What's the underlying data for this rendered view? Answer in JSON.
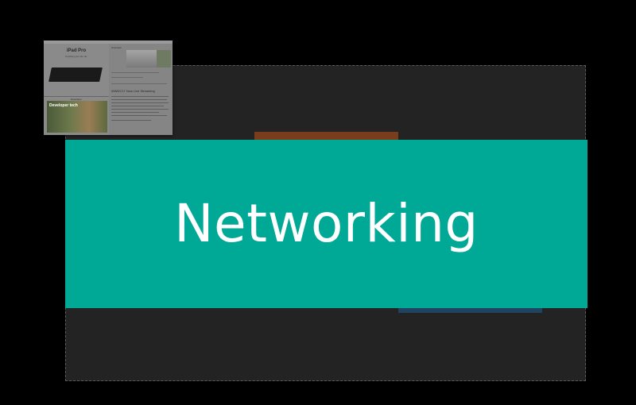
{
  "banner": {
    "title": "Networking",
    "background_color": "#00a896",
    "text_color": "#ffffff"
  },
  "thumbnail": {
    "left_panel": {
      "product_title": "iPad Pro",
      "product_subtitle": "Anything you can do.",
      "developer_section_label": "Developer",
      "developer_banner_text": "Developer tech"
    },
    "right_panel": {
      "header": "Overview",
      "article_title": "WWDC17 Now Live Streaming"
    }
  },
  "colors": {
    "page_background": "#000000",
    "canvas_background": "#232323",
    "orange_accent": "#7a3d1c",
    "blue_accent": "#1f4361"
  }
}
